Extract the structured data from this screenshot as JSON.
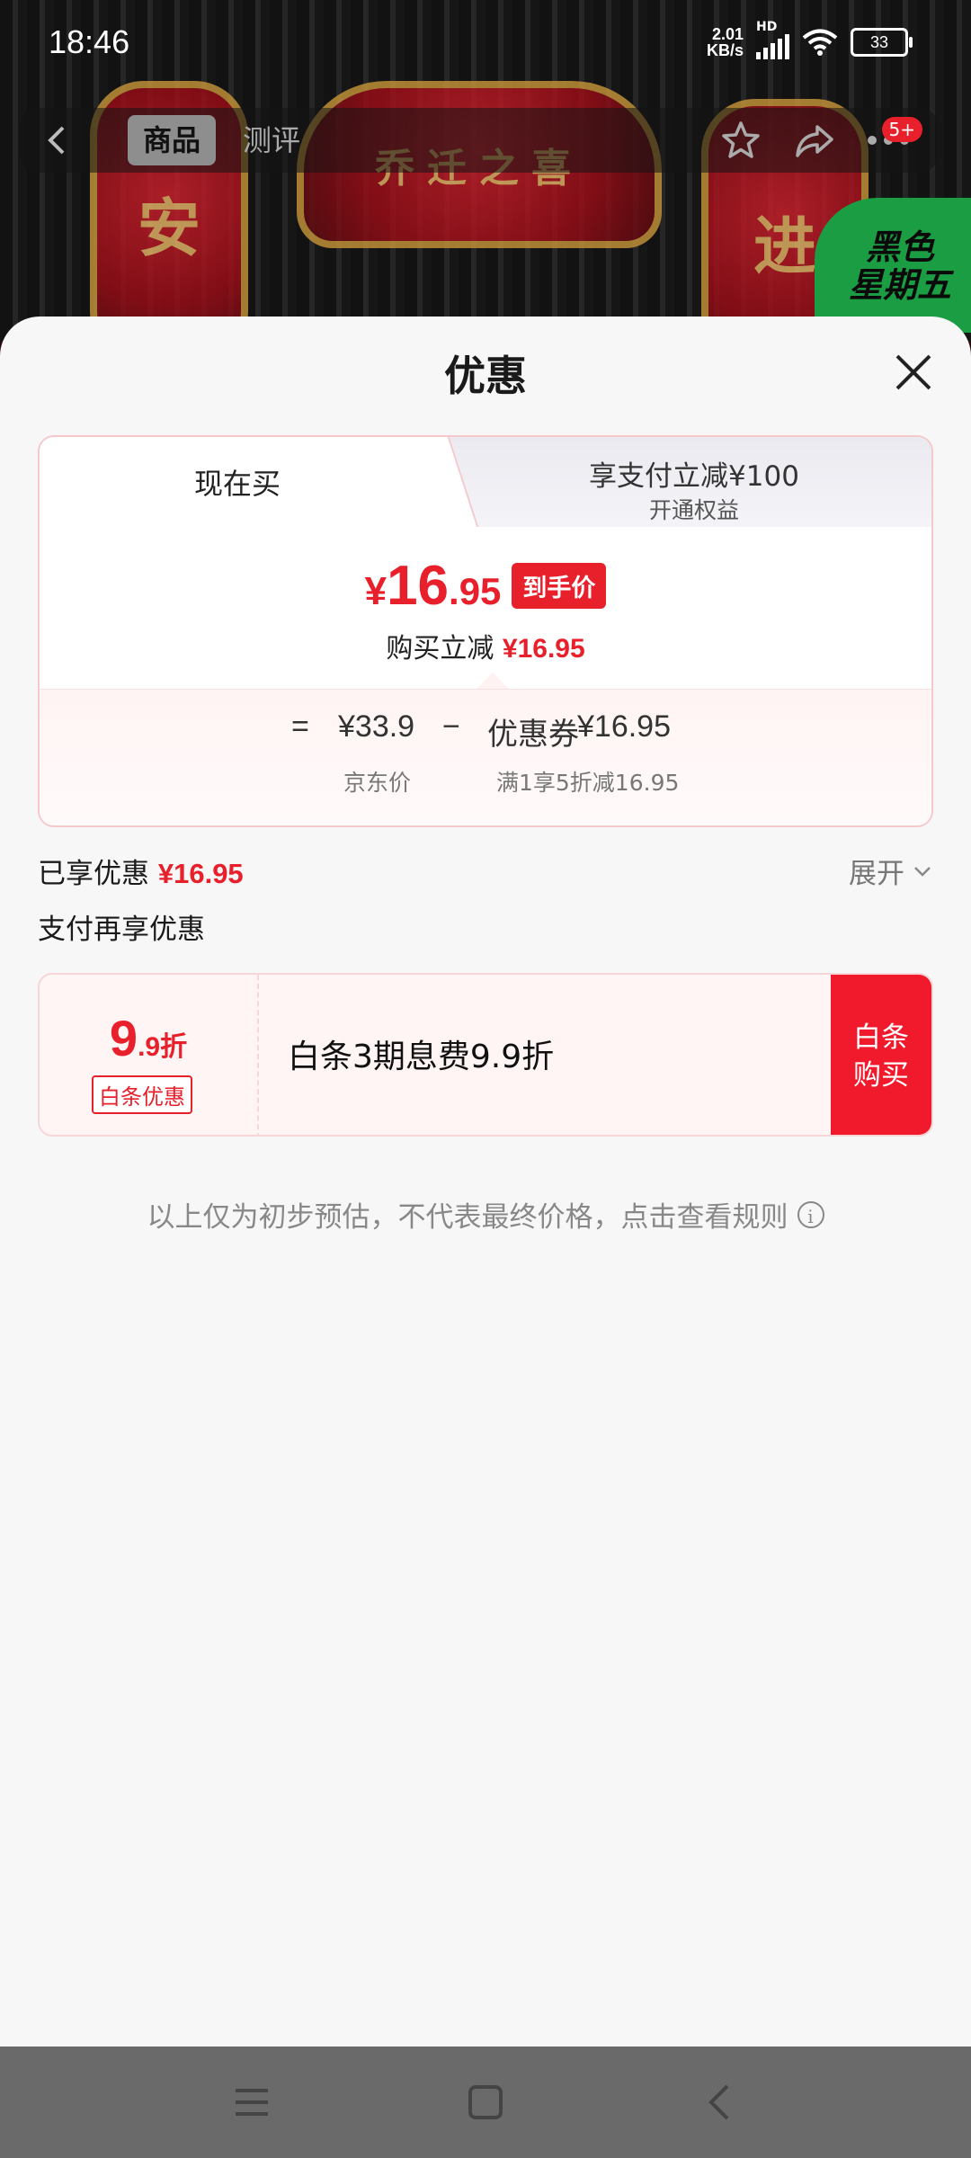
{
  "status_bar": {
    "time": "18:46",
    "net_speed_value": "2.01",
    "net_speed_unit": "KB/s",
    "network_type": "HD",
    "battery": "33"
  },
  "product_nav": {
    "tabs": [
      {
        "label": "商品",
        "active": true
      },
      {
        "label": "测评",
        "active": false
      }
    ],
    "cart_badge": "5+"
  },
  "background": {
    "banner_left": "安",
    "banner_arch": "乔迁之喜",
    "banner_right": "进",
    "promo_badge": "黑色\n星期五"
  },
  "sheet": {
    "title": "优惠",
    "tabs": {
      "buy_now": "现在买",
      "pay_discount_title": "享支付立减¥100",
      "pay_discount_sub": "开通权益"
    },
    "final_price": {
      "currency": "¥",
      "integer": "16",
      "decimal": ".95",
      "badge": "到手价"
    },
    "instant_discount": {
      "label": "购买立减",
      "amount": "¥16.95"
    },
    "breakdown": {
      "equals": "=",
      "jd_price": "¥33.9",
      "minus": "−",
      "coupon_label": "优惠券",
      "coupon_amount": "¥16.95",
      "jd_price_label": "京东价",
      "coupon_rule": "满1享5折减16.95"
    },
    "enjoyed": {
      "label": "已享优惠",
      "amount": "¥16.95",
      "expand": "展开"
    },
    "pay_more_label": "支付再享优惠",
    "baitiao": {
      "rate_big": "9",
      "rate_small": ".9折",
      "tag": "白条优惠",
      "description": "白条3期息费9.9折",
      "buy_button": "白条购买"
    },
    "disclaimer": "以上仅为初步预估，不代表最终价格，点击查看规则"
  },
  "colors": {
    "accent_red": "#e8202b",
    "sheet_bg": "#f7f7f7",
    "nav_bar_bg": "#6a6a6a"
  }
}
